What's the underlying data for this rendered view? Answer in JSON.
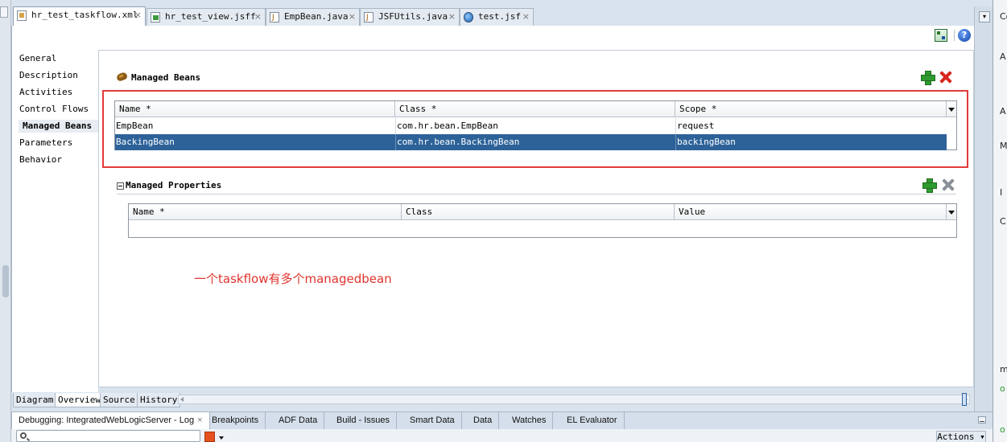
{
  "editor_tabs": [
    {
      "label": "hr_test_taskflow.xml",
      "icon": "xml-file-icon",
      "active": true
    },
    {
      "label": "hr_test_view.jsff",
      "icon": "jsff-file-icon",
      "active": false
    },
    {
      "label": "EmpBean.java",
      "icon": "java-file-icon",
      "active": false
    },
    {
      "label": "JSFUtils.java",
      "icon": "java-file-icon",
      "active": false
    },
    {
      "label": "test.jsf",
      "icon": "jsf-file-icon",
      "active": false
    }
  ],
  "close_glyph": "×",
  "toolbar": {
    "help_label": "?"
  },
  "sidenav": {
    "items": [
      "General",
      "Description",
      "Activities",
      "Control Flows",
      "Managed Beans",
      "Parameters",
      "Behavior"
    ],
    "selected": "Managed Beans"
  },
  "managed_beans": {
    "title": "Managed Beans",
    "columns": [
      "Name *",
      "Class *",
      "Scope *"
    ],
    "rows": [
      {
        "name": "EmpBean",
        "class": "com.hr.bean.EmpBean",
        "scope": "request",
        "selected": false
      },
      {
        "name": "BackingBean",
        "class": "com.hr.bean.BackingBean",
        "scope": "backingBean",
        "selected": true
      }
    ]
  },
  "managed_properties": {
    "title": "Managed Properties",
    "columns": [
      "Name *",
      "Class",
      "Value"
    ]
  },
  "annotation": "一个taskflow有多个managedbean",
  "bottom_tabs": [
    "Diagram",
    "Overview",
    "Source",
    "History"
  ],
  "bottom_tab_active": "Overview",
  "debug_tabs": [
    {
      "label": "Debugging: IntegratedWebLogicServer - Log",
      "active": true
    },
    {
      "label": "Breakpoints"
    },
    {
      "label": "ADF Data"
    },
    {
      "label": "Build - Issues"
    },
    {
      "label": "Smart Data"
    },
    {
      "label": "Data"
    },
    {
      "label": "Watches"
    },
    {
      "label": "EL Evaluator"
    }
  ],
  "actions_label": "Actions",
  "right_panel_glyphs": [
    "Co",
    "A",
    "A",
    "M",
    "I",
    "C",
    "m",
    "o",
    "o"
  ],
  "colors": {
    "selection": "#2d6299",
    "annotation_red": "#e0342e",
    "highlight_box": "#e23a3a",
    "add_green": "#2e9a2e",
    "delete_red": "#d8261f"
  }
}
